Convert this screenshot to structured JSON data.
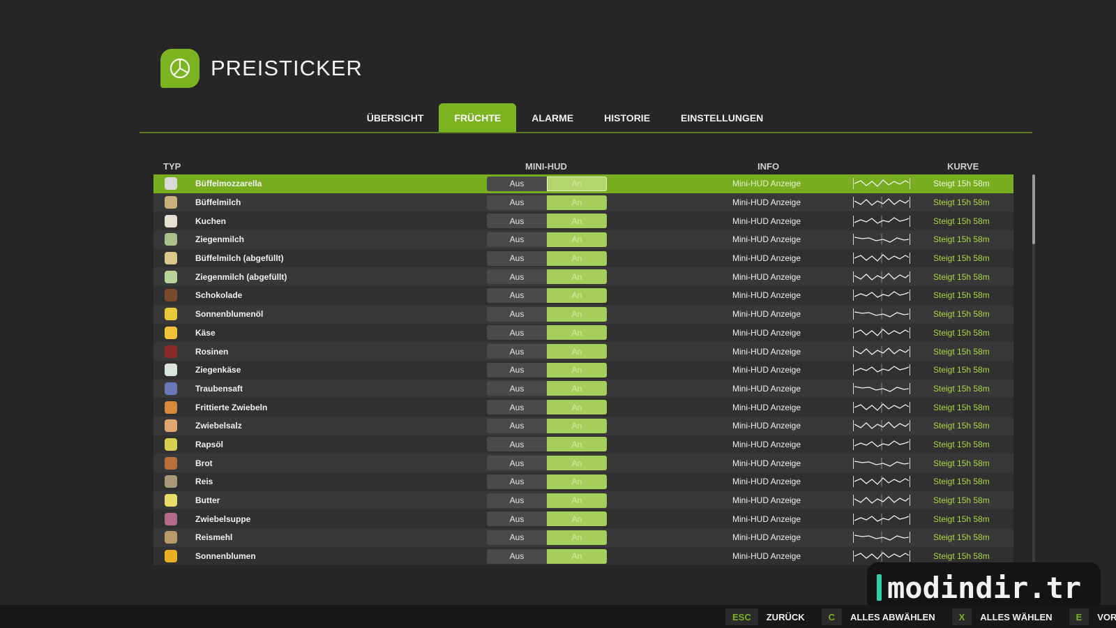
{
  "app": {
    "title": "PREISTICKER",
    "logo_icon": "pie-chart-icon",
    "accent": "#7cb321"
  },
  "tabs": [
    {
      "label": "ÜBERSICHT",
      "active": false
    },
    {
      "label": "FRÜCHTE",
      "active": true
    },
    {
      "label": "ALARME",
      "active": false
    },
    {
      "label": "HISTORIE",
      "active": false
    },
    {
      "label": "EINSTELLUNGEN",
      "active": false
    }
  ],
  "columns": {
    "type": "TYP",
    "minihud": "MINI-HUD",
    "info": "INFO",
    "curve": "KURVE"
  },
  "rows": [
    {
      "name": "Büffelmozzarella",
      "off": "Aus",
      "on": "An",
      "info": "Mini-HUD Anzeige",
      "trend": "Steigt 15h 58m",
      "icon": "mozzarella-icon",
      "color": "#d9d9d9"
    },
    {
      "name": "Büffelmilch",
      "off": "Aus",
      "on": "An",
      "info": "Mini-HUD Anzeige",
      "trend": "Steigt 15h 58m",
      "icon": "milk-bottle-icon",
      "color": "#c9b27a"
    },
    {
      "name": "Kuchen",
      "off": "Aus",
      "on": "An",
      "info": "Mini-HUD Anzeige",
      "trend": "Steigt 15h 58m",
      "icon": "cake-icon",
      "color": "#e6e0d2"
    },
    {
      "name": "Ziegenmilch",
      "off": "Aus",
      "on": "An",
      "info": "Mini-HUD Anzeige",
      "trend": "Steigt 15h 58m",
      "icon": "milk-bottle-icon",
      "color": "#a9c08a"
    },
    {
      "name": "Büffelmilch (abgefüllt)",
      "off": "Aus",
      "on": "An",
      "info": "Mini-HUD Anzeige",
      "trend": "Steigt 15h 58m",
      "icon": "bottled-milk-icon",
      "color": "#d8c98b"
    },
    {
      "name": "Ziegenmilch (abgefüllt)",
      "off": "Aus",
      "on": "An",
      "info": "Mini-HUD Anzeige",
      "trend": "Steigt 15h 58m",
      "icon": "bottled-milk-icon",
      "color": "#b9d39a"
    },
    {
      "name": "Schokolade",
      "off": "Aus",
      "on": "An",
      "info": "Mini-HUD Anzeige",
      "trend": "Steigt 15h 58m",
      "icon": "chocolate-icon",
      "color": "#7a4a2a"
    },
    {
      "name": "Sonnenblumenöl",
      "off": "Aus",
      "on": "An",
      "info": "Mini-HUD Anzeige",
      "trend": "Steigt 15h 58m",
      "icon": "oil-bottle-icon",
      "color": "#e8c93a"
    },
    {
      "name": "Käse",
      "off": "Aus",
      "on": "An",
      "info": "Mini-HUD Anzeige",
      "trend": "Steigt 15h 58m",
      "icon": "cheese-icon",
      "color": "#f0c23a"
    },
    {
      "name": "Rosinen",
      "off": "Aus",
      "on": "An",
      "info": "Mini-HUD Anzeige",
      "trend": "Steigt 15h 58m",
      "icon": "raisins-icon",
      "color": "#8a2a2a"
    },
    {
      "name": "Ziegenkäse",
      "off": "Aus",
      "on": "An",
      "info": "Mini-HUD Anzeige",
      "trend": "Steigt 15h 58m",
      "icon": "goat-cheese-icon",
      "color": "#d8e4dc"
    },
    {
      "name": "Traubensaft",
      "off": "Aus",
      "on": "An",
      "info": "Mini-HUD Anzeige",
      "trend": "Steigt 15h 58m",
      "icon": "juice-icon",
      "color": "#6a78b8"
    },
    {
      "name": "Frittierte Zwiebeln",
      "off": "Aus",
      "on": "An",
      "info": "Mini-HUD Anzeige",
      "trend": "Steigt 15h 58m",
      "icon": "fried-onions-icon",
      "color": "#d88a3a"
    },
    {
      "name": "Zwiebelsalz",
      "off": "Aus",
      "on": "An",
      "info": "Mini-HUD Anzeige",
      "trend": "Steigt 15h 58m",
      "icon": "onion-salt-icon",
      "color": "#e0a870"
    },
    {
      "name": "Rapsöl",
      "off": "Aus",
      "on": "An",
      "info": "Mini-HUD Anzeige",
      "trend": "Steigt 15h 58m",
      "icon": "oil-bottle-icon",
      "color": "#d6d050"
    },
    {
      "name": "Brot",
      "off": "Aus",
      "on": "An",
      "info": "Mini-HUD Anzeige",
      "trend": "Steigt 15h 58m",
      "icon": "bread-icon",
      "color": "#b8703a"
    },
    {
      "name": "Reis",
      "off": "Aus",
      "on": "An",
      "info": "Mini-HUD Anzeige",
      "trend": "Steigt 15h 58m",
      "icon": "rice-icon",
      "color": "#a89878"
    },
    {
      "name": "Butter",
      "off": "Aus",
      "on": "An",
      "info": "Mini-HUD Anzeige",
      "trend": "Steigt 15h 58m",
      "icon": "butter-icon",
      "color": "#e8dc6a"
    },
    {
      "name": "Zwiebelsuppe",
      "off": "Aus",
      "on": "An",
      "info": "Mini-HUD Anzeige",
      "trend": "Steigt 15h 58m",
      "icon": "soup-can-icon",
      "color": "#b86a8a"
    },
    {
      "name": "Reismehl",
      "off": "Aus",
      "on": "An",
      "info": "Mini-HUD Anzeige",
      "trend": "Steigt 15h 58m",
      "icon": "flour-bag-icon",
      "color": "#b89a6a"
    },
    {
      "name": "Sonnenblumen",
      "off": "Aus",
      "on": "An",
      "info": "Mini-HUD Anzeige",
      "trend": "Steigt 15h 58m",
      "icon": "sunflower-icon",
      "color": "#e8b020"
    }
  ],
  "watermark": "modindir.tr",
  "footer": [
    {
      "key": "ESC",
      "label": "ZURÜCK"
    },
    {
      "key": "C",
      "label": "ALLES ABWÄHLEN"
    },
    {
      "key": "X",
      "label": "ALLES WÄHLEN"
    },
    {
      "key": "E",
      "label": "VORH"
    }
  ]
}
